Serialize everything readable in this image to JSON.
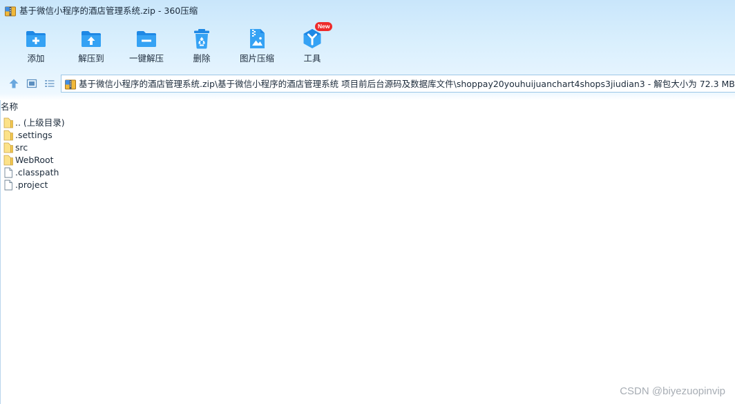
{
  "window": {
    "title": "基于微信小程序的酒店管理系统.zip - 360压缩"
  },
  "toolbar": {
    "items": [
      {
        "label": "添加",
        "icon": "add-folder-icon"
      },
      {
        "label": "解压到",
        "icon": "extract-to-icon"
      },
      {
        "label": "一键解压",
        "icon": "one-click-extract-icon"
      },
      {
        "label": "删除",
        "icon": "recycle-bin-icon"
      },
      {
        "label": "图片压缩",
        "icon": "image-compress-icon"
      },
      {
        "label": "工具",
        "icon": "tools-icon",
        "badge": "New"
      }
    ]
  },
  "navigation": {
    "address": "基于微信小程序的酒店管理系统.zip\\基于微信小程序的酒店管理系统 项目前后台源码及数据库文件\\shoppay20youhuijuanchart4shops3jiudian3 - 解包大小为 72.3 MB"
  },
  "filelist": {
    "column_header": "名称",
    "rows": [
      {
        "name": ".. (上级目录)",
        "type": "folder"
      },
      {
        "name": ".settings",
        "type": "folder"
      },
      {
        "name": "src",
        "type": "folder"
      },
      {
        "name": "WebRoot",
        "type": "folder"
      },
      {
        "name": ".classpath",
        "type": "file"
      },
      {
        "name": ".project",
        "type": "file"
      }
    ]
  },
  "watermark": "CSDN @biyezuopinvip",
  "colors": {
    "accent": "#2196f3",
    "folder": "#fcd966",
    "badge": "#ee2b2b"
  }
}
